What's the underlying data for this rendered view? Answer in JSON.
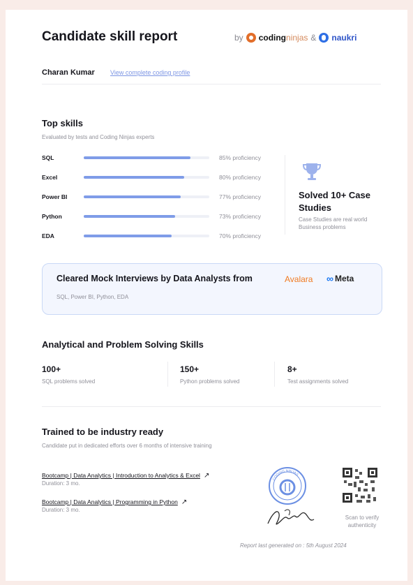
{
  "header": {
    "title": "Candidate skill report",
    "by_text": "by",
    "brand_coding": "coding",
    "brand_ninjas": "ninjas",
    "amp": "&",
    "brand_naukri": "naukri"
  },
  "candidate": {
    "name": "Charan Kumar",
    "profile_link": "View complete coding profile"
  },
  "top_skills": {
    "title": "Top skills",
    "subtitle": "Evaluated by tests and Coding Ninjas experts",
    "skills": [
      {
        "name": "SQL",
        "proficiency": 85,
        "label": "85% proficiency"
      },
      {
        "name": "Excel",
        "proficiency": 80,
        "label": "80% proficiency"
      },
      {
        "name": "Power BI",
        "proficiency": 77,
        "label": "77% proficiency"
      },
      {
        "name": "Python",
        "proficiency": 73,
        "label": "73% proficiency"
      },
      {
        "name": "EDA",
        "proficiency": 70,
        "label": "70% proficiency"
      }
    ]
  },
  "case_studies": {
    "title": "Solved 10+ Case Studies",
    "subtitle": "Case Studies are real world Business problems",
    "icon": "trophy-icon"
  },
  "mock_interviews": {
    "title": "Cleared Mock Interviews by Data Analysts from",
    "company1": "Avalara",
    "company2": "Meta",
    "subtitle": "SQL, Power BI, Python, EDA"
  },
  "analytical": {
    "title": "Analytical and Problem Solving Skills",
    "stats": [
      {
        "value": "100+",
        "label": "SQL problems solved"
      },
      {
        "value": "150+",
        "label": "Python problems solved"
      },
      {
        "value": "8+",
        "label": "Test assignments solved"
      }
    ]
  },
  "training": {
    "title": "Trained to be industry ready",
    "subtitle": "Candidate put in dedicated efforts over 6 months of intensive training",
    "courses": [
      {
        "name": "Bootcamp | Data Analytics | Introduction to Analytics & Excel",
        "duration": "Duration: 3 mo."
      },
      {
        "name": "Bootcamp | Data Analytics | Programming in Python",
        "duration": "Duration: 3 mo."
      }
    ]
  },
  "verification": {
    "seal_text": "CODING NINJAS",
    "scan_text": "Scan to verify authenticity",
    "report_date": "Report last generated on : 5th August 2024"
  },
  "colors": {
    "accent": "#7f9ce8",
    "background": "#f9ece8",
    "avalara": "#f07b22",
    "coding_ninjas": "#e26e2a",
    "naukri": "#2f6fe5"
  }
}
